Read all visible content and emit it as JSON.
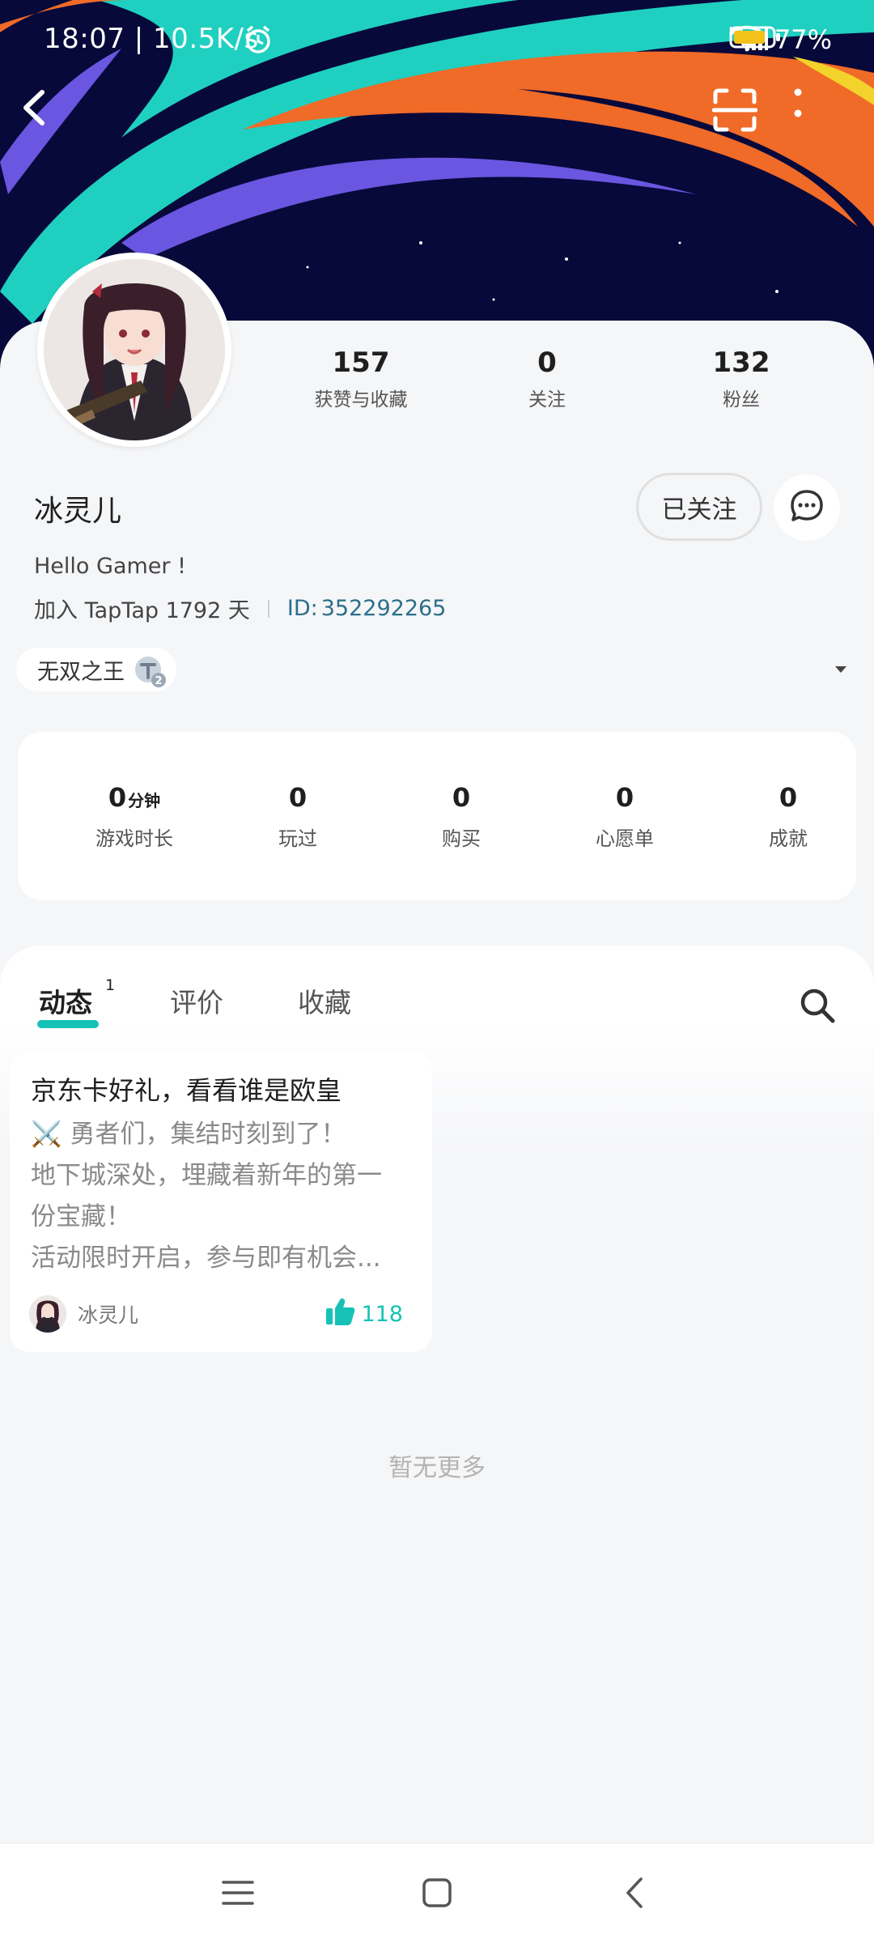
{
  "status_bar": {
    "time": "18:07 | 10.5K/s",
    "battery": "77%",
    "icons": [
      "alarm-icon",
      "signal-hd-icon",
      "signal-hd-icon",
      "wifi-icon",
      "battery-icon"
    ]
  },
  "topbar": {
    "back_icon": "chevron-left-icon",
    "scan_icon": "scan-icon",
    "more_icon": "more-vertical-icon"
  },
  "profile": {
    "name": "冰灵儿",
    "bio": "Hello Gamer !",
    "joined": "加入 TapTap 1792 天",
    "id_label": "ID:",
    "id_value": "352292265",
    "follow_button": "已关注",
    "message_icon": "chat-bubble-icon",
    "counts": [
      {
        "value": "157",
        "label": "获赞与收藏"
      },
      {
        "value": "0",
        "label": "关注"
      },
      {
        "value": "132",
        "label": "粉丝"
      }
    ],
    "badge": {
      "label": "无双之王",
      "level": "2"
    }
  },
  "stats": [
    {
      "value": "0",
      "unit": "分钟",
      "label": "游戏时长"
    },
    {
      "value": "0",
      "unit": "",
      "label": "玩过"
    },
    {
      "value": "0",
      "unit": "",
      "label": "购买"
    },
    {
      "value": "0",
      "unit": "",
      "label": "心愿单"
    },
    {
      "value": "0",
      "unit": "",
      "label": "成就"
    }
  ],
  "tabs": [
    {
      "label": "动态",
      "count": "1",
      "active": true
    },
    {
      "label": "评价",
      "count": "",
      "active": false
    },
    {
      "label": "收藏",
      "count": "",
      "active": false
    }
  ],
  "post": {
    "title": "京东卡好礼，看看谁是欧皇",
    "body_lines": [
      "⚔️ 勇者们，集结时刻到了！",
      "地下城深处，埋藏着新年的第一",
      "份宝藏！",
      "活动限时开启，参与即有机会..."
    ],
    "author": "冰灵儿",
    "likes": "118"
  },
  "footer_text": "暂无更多",
  "colors": {
    "accent": "#16c2b5",
    "id_link": "#2b6f8a",
    "banner_bg": "#07093a",
    "banner_teal": "#1fd0c0",
    "banner_orange": "#f06a28",
    "banner_purple": "#6a56e0"
  }
}
